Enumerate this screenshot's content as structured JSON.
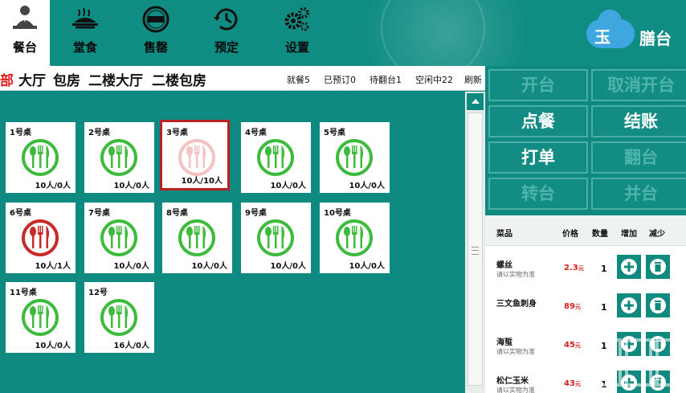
{
  "colors": {
    "teal_bg": "#0f8a80",
    "accent_red": "#e21d1d",
    "available_green": "#3dbb3d",
    "occupied_red": "#c82a2a",
    "selected_pink": "#f4c2c2"
  },
  "nav": {
    "items": [
      {
        "label": "餐台",
        "icon": "waiter-icon",
        "active": true
      },
      {
        "label": "堂食",
        "icon": "dish-icon"
      },
      {
        "label": "售罄",
        "icon": "sold-out-icon"
      },
      {
        "label": "预定",
        "icon": "reservation-clock-icon"
      },
      {
        "label": "设置",
        "icon": "gears-icon"
      }
    ]
  },
  "logo": {
    "char1": "玉",
    "char2": "膳台"
  },
  "filter": {
    "categories": [
      "部",
      "大厅",
      "包房",
      "二楼大厅",
      "二楼包房"
    ],
    "stats": [
      "就餐5",
      "已预订0",
      "待翻台1",
      "空闲中22"
    ],
    "refresh": "刷新"
  },
  "tables": [
    {
      "name": "1号桌",
      "capacity": "10人/0人",
      "status": "available"
    },
    {
      "name": "2号桌",
      "capacity": "10人/0人",
      "status": "available"
    },
    {
      "name": "3号桌",
      "capacity": "10人/10人",
      "status": "selected"
    },
    {
      "name": "4号桌",
      "capacity": "10人/0人",
      "status": "available"
    },
    {
      "name": "5号桌",
      "capacity": "10人/0人",
      "status": "available"
    },
    {
      "name": "6号桌",
      "capacity": "10人/1人",
      "status": "occupied"
    },
    {
      "name": "7号桌",
      "capacity": "10人/0人",
      "status": "available"
    },
    {
      "name": "8号桌",
      "capacity": "10人/0人",
      "status": "available"
    },
    {
      "name": "9号桌",
      "capacity": "10人/0人",
      "status": "available"
    },
    {
      "name": "10号桌",
      "capacity": "10人/0人",
      "status": "available"
    },
    {
      "name": "11号桌",
      "capacity": "10人/0人",
      "status": "available"
    },
    {
      "name": "12号",
      "capacity": "16人/0人",
      "status": "available"
    }
  ],
  "actions": [
    {
      "label": "开台",
      "enabled": false
    },
    {
      "label": "取消开台",
      "enabled": false
    },
    {
      "label": "点餐",
      "enabled": true
    },
    {
      "label": "结账",
      "enabled": true
    },
    {
      "label": "打单",
      "enabled": true
    },
    {
      "label": "翻台",
      "enabled": false
    },
    {
      "label": "转台",
      "enabled": false
    },
    {
      "label": "并台",
      "enabled": false
    }
  ],
  "order": {
    "headers": {
      "dish": "菜品",
      "price": "价格",
      "qty": "数量",
      "add": "增加",
      "remove": "减少"
    },
    "currency_unit": "元",
    "rows": [
      {
        "name": "螺丝",
        "note": "请以实物为准",
        "price": "2.3",
        "qty": "1"
      },
      {
        "name": "三文鱼刺身",
        "note": "",
        "price": "89",
        "qty": "1"
      },
      {
        "name": "海蜇",
        "note": "请以实物为准",
        "price": "45",
        "qty": "1"
      },
      {
        "name": "松仁玉米",
        "note": "请以实物为准",
        "price": "43",
        "qty": "1"
      }
    ]
  }
}
